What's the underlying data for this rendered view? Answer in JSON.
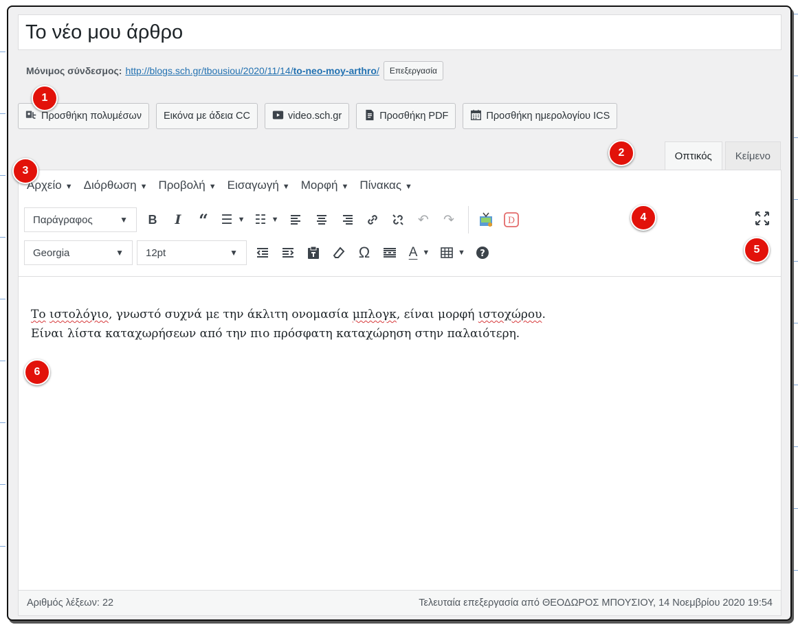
{
  "title": "Το νέο μου άρθρο",
  "permalink": {
    "label": "Μόνιμος σύνδεσμος:",
    "url_base": "http://blogs.sch.gr/tbousiou/2020/11/14/",
    "slug": "to-neo-moy-arthro",
    "url_tail": "/",
    "edit_label": "Επεξεργασία"
  },
  "media_buttons": [
    {
      "label": "Προσθήκη πολυμέσων",
      "icon": "add-media-icon"
    },
    {
      "label": "Εικόνα με άδεια CC",
      "icon": ""
    },
    {
      "label": "video.sch.gr",
      "icon": "video-play-icon"
    },
    {
      "label": "Προσθήκη PDF",
      "icon": "pdf-document-icon"
    },
    {
      "label": "Προσθήκη ημερολογίου ICS",
      "icon": "calendar-icon"
    }
  ],
  "tabs": {
    "visual": "Οπτικός",
    "text": "Κείμενο"
  },
  "menubar": [
    "Αρχείο",
    "Διόρθωση",
    "Προβολή",
    "Εισαγωγή",
    "Μορφή",
    "Πίνακας"
  ],
  "toolbar": {
    "format_select": "Παράγραφος",
    "font_family": "Georgia",
    "font_size": "12pt"
  },
  "content": {
    "line1_parts": [
      "Το",
      " ",
      "ιστολόγιο",
      ", γνωστό συχνά με την άκλιτη ονομασία ",
      "μπλογκ",
      ", είναι μορφή ",
      "ιστοχώρου",
      "."
    ],
    "line2": "Είναι λίστα καταχωρήσεων από την πιο πρόσφατη καταχώρηση στην παλαιότερη."
  },
  "status": {
    "word_count": "Αριθμός λέξεων: 22",
    "last_edit": "Τελευταία επεξεργασία από ΘΕΟΔΩΡΟΣ ΜΠΟΥΣΙΟΥ, 14 Νοεμβρίου 2020 19:54"
  },
  "callouts": [
    "1",
    "2",
    "3",
    "4",
    "5",
    "6"
  ],
  "colors": {
    "callout": "#e2120a",
    "link": "#2271b1"
  }
}
